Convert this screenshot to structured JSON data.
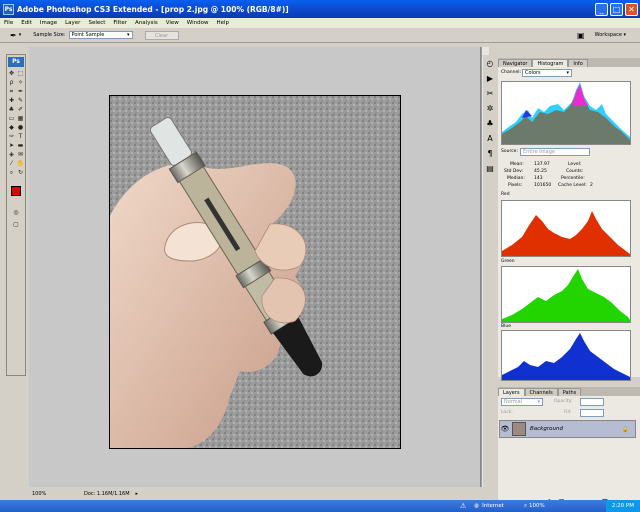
{
  "window": {
    "title": "Adobe Photoshop CS3 Extended - [prop 2.jpg @ 100% (RGB/8#)]",
    "app_icon": "Ps",
    "min": "_",
    "max": "□",
    "close": "✕"
  },
  "menu": [
    "File",
    "Edit",
    "Image",
    "Layer",
    "Select",
    "Filter",
    "Analysis",
    "View",
    "Window",
    "Help"
  ],
  "options": {
    "sample_label": "Sample Size:",
    "sample_value": "Point Sample",
    "clear_label": "Clear",
    "workspace_label": "Workspace ▾"
  },
  "toolbox": {
    "logo": "Ps"
  },
  "status": {
    "zoom": "100%",
    "doc": "Doc: 1.16M/1.16M"
  },
  "panels": {
    "tabs_top": [
      "Navigator",
      "Histogram",
      "Info"
    ],
    "channel_label": "Channel:",
    "channel_value": "Colors",
    "source_label": "Source:",
    "source_value": "Entire Image",
    "stats": {
      "mean_label": "Mean:",
      "mean": "137.97",
      "stddev_label": "Std Dev:",
      "stddev": "45.25",
      "median_label": "Median:",
      "median": "143",
      "pixels_label": "Pixels:",
      "pixels": "101650",
      "level_label": "Level:",
      "counts_label": "Counts:",
      "percentile_label": "Percentile:",
      "cache_label": "Cache Level:",
      "cache": "2"
    },
    "hist_labels": {
      "red": "Red",
      "green": "Green",
      "blue": "Blue"
    },
    "colors": {
      "red": "#e03000",
      "green": "#22d400",
      "blue": "#1030d0"
    },
    "tabs_bottom": [
      "Layers",
      "Channels",
      "Paths"
    ],
    "blend_value": "Normal",
    "opacity_label": "Opacity:",
    "lock_label": "Lock:",
    "fill_label": "Fill:",
    "layer_name": "Background"
  },
  "taskbar": {
    "internet": "Internet",
    "zoom": "100%",
    "time": "2:20 PM"
  }
}
